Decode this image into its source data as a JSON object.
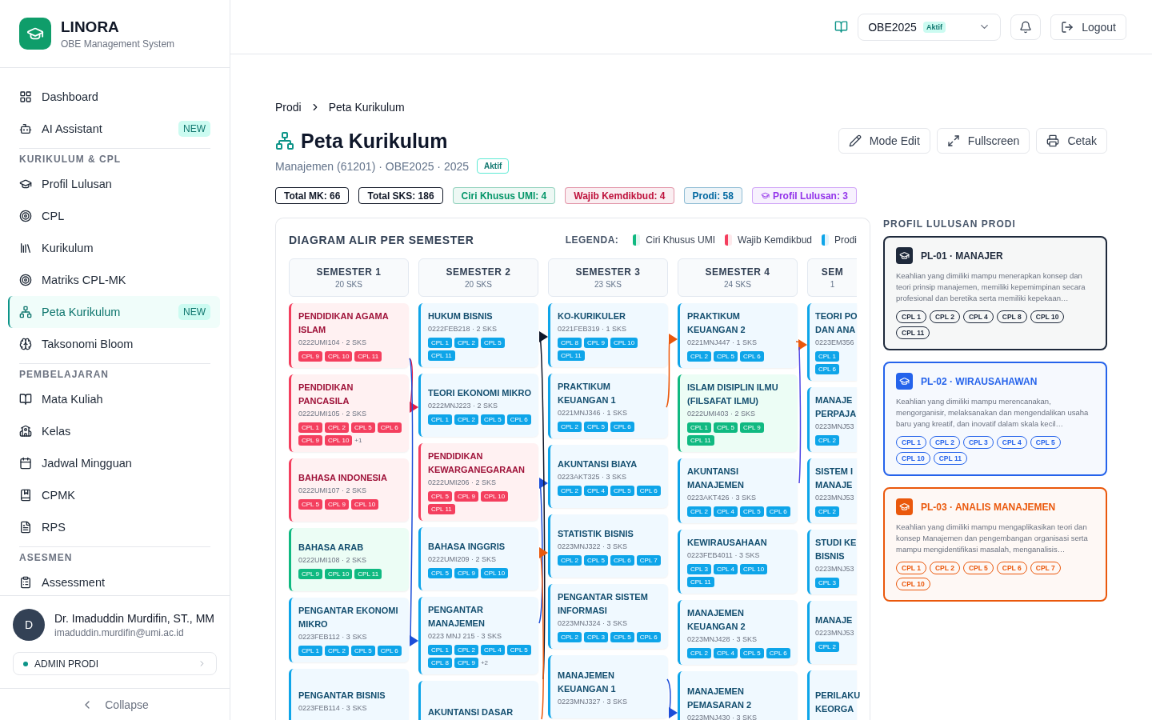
{
  "brand": {
    "name": "LINORA",
    "tagline": "OBE Management System"
  },
  "nav": [
    {
      "items": [
        {
          "label": "Dashboard",
          "kind": "dashboard",
          "selected": false
        },
        {
          "label": "AI Assistant",
          "kind": "bot",
          "selected": false,
          "badge": "NEW"
        }
      ]
    },
    {
      "heading": "KURIKULUM & CPL",
      "items": [
        {
          "label": "Profil Lulusan",
          "kind": "cap",
          "selected": false
        },
        {
          "label": "CPL",
          "kind": "target",
          "selected": false
        },
        {
          "label": "Kurikulum",
          "kind": "library",
          "selected": false
        },
        {
          "label": "Matriks CPL-MK",
          "kind": "target",
          "selected": false
        },
        {
          "label": "Peta Kurikulum",
          "kind": "network",
          "selected": true,
          "badge": "NEW"
        },
        {
          "label": "Taksonomi Bloom",
          "kind": "brain",
          "selected": false
        }
      ]
    },
    {
      "heading": "PEMBELAJARAN",
      "items": [
        {
          "label": "Mata Kuliah",
          "kind": "book",
          "selected": false
        },
        {
          "label": "Kelas",
          "kind": "school",
          "selected": false
        },
        {
          "label": "Jadwal Mingguan",
          "kind": "calendar",
          "selected": false
        },
        {
          "label": "CPMK",
          "kind": "bookmark",
          "selected": false
        },
        {
          "label": "RPS",
          "kind": "file",
          "selected": false
        }
      ]
    },
    {
      "heading": "ASESMEN",
      "items": [
        {
          "label": "Assessment",
          "kind": "clipboard",
          "selected": false
        }
      ]
    }
  ],
  "user": {
    "initial": "D",
    "name": "Dr. Imaduddin Murdifin, ST., MM",
    "email": "imaduddin.murdifin@umi.ac.id",
    "role": "ADMIN PRODI"
  },
  "collapse": "Collapse",
  "topbar": {
    "curriculum": "OBE2025",
    "curriculum_badge": "Aktif",
    "logout": "Logout"
  },
  "breadcrumb": [
    "Prodi",
    "Peta Kurikulum"
  ],
  "title": "Peta Kurikulum",
  "subtitle": "Manajemen (61201) · OBE2025 · 2025",
  "status_badge": "Aktif",
  "actions": [
    {
      "label": "Mode Edit",
      "kind": "edit"
    },
    {
      "label": "Fullscreen",
      "kind": "fullscreen"
    },
    {
      "label": "Cetak",
      "kind": "print"
    }
  ],
  "stats": [
    {
      "label": "Total MK: 66",
      "color": "#111827"
    },
    {
      "label": "Total SKS: 186",
      "color": "#111827"
    },
    {
      "label": "Ciri Khusus UMI: 4",
      "color": "#059669"
    },
    {
      "label": "Wajib Kemdikbud: 4",
      "color": "#be123c"
    },
    {
      "label": "Prodi: 58",
      "color": "#0369a1"
    },
    {
      "label": "Profil Lulusan: 3",
      "color": "#9333ea",
      "kind": "cap"
    }
  ],
  "diagram": {
    "title": "DIAGRAM ALIR PER SEMESTER",
    "legend_title": "LEGENDA:",
    "legend": [
      {
        "label": "Ciri Khusus UMI",
        "color": "#10b981"
      },
      {
        "label": "Wajib Kemdikbud",
        "color": "#f43f5e"
      },
      {
        "label": "Prodi",
        "color": "#0ea5e9"
      }
    ],
    "semesters": [
      {
        "title": "SEMESTER 1",
        "sks": "20 SKS",
        "courses": [
          {
            "name": "PENDIDIKAN AGAMA ISLAM",
            "meta": "0222UMI104 · 2 SKS",
            "kind": "kemdikbud",
            "cpl": [
              "CPL 9",
              "CPL 10",
              "CPL 11"
            ]
          },
          {
            "name": "PENDIDIKAN PANCASILA",
            "meta": "0222UMI105 · 2 SKS",
            "kind": "kemdikbud",
            "cpl": [
              "CPL 1",
              "CPL 2",
              "CPL 5",
              "CPL 6",
              "CPL 9",
              "CPL 10"
            ],
            "more": "+1"
          },
          {
            "name": "BAHASA INDONESIA",
            "meta": "0222UMI107 · 2 SKS",
            "kind": "kemdikbud",
            "cpl": [
              "CPL 5",
              "CPL 9",
              "CPL 10"
            ]
          },
          {
            "name": "BAHASA ARAB",
            "meta": "0222UMI108 · 2 SKS",
            "kind": "umi",
            "cpl": [
              "CPL 9",
              "CPL 10",
              "CPL 11"
            ]
          },
          {
            "name": "PENGANTAR EKONOMI MIKRO",
            "meta": "0223FEB112 · 3 SKS",
            "kind": "prodi",
            "cpl": [
              "CPL 1",
              "CPL 2",
              "CPL 5",
              "CPL 6"
            ]
          },
          {
            "name": "PENGANTAR BISNIS",
            "meta": "0223FEB114 · 3 SKS",
            "kind": "prodi"
          }
        ]
      },
      {
        "title": "SEMESTER 2",
        "sks": "20 SKS",
        "courses": [
          {
            "name": "HUKUM BISNIS",
            "meta": "0222FEB218 · 2 SKS",
            "kind": "prodi",
            "cpl": [
              "CPL 1",
              "CPL 2",
              "CPL 5",
              "CPL 11"
            ]
          },
          {
            "name": "TEORI EKONOMI MIKRO",
            "meta": "0222MNJ223 · 2 SKS",
            "kind": "prodi",
            "cpl": [
              "CPL 1",
              "CPL 2",
              "CPL 5",
              "CPL 6"
            ]
          },
          {
            "name": "PENDIDIKAN KEWARGANEGARAAN",
            "meta": "0222UMI206 · 2 SKS",
            "kind": "kemdikbud",
            "cpl": [
              "CPL 5",
              "CPL 9",
              "CPL 10",
              "CPL 11"
            ]
          },
          {
            "name": "BAHASA INGGRIS",
            "meta": "0222UMI209 · 2 SKS",
            "kind": "prodi",
            "cpl": [
              "CPL 5",
              "CPL 9",
              "CPL 10"
            ]
          },
          {
            "name": "PENGANTAR MANAJEMEN",
            "meta": "0223 MNJ 215 · 3 SKS",
            "kind": "prodi",
            "cpl": [
              "CPL 1",
              "CPL 2",
              "CPL 4",
              "CPL 5",
              "CPL 8",
              "CPL 9"
            ],
            "more": "+2"
          },
          {
            "name": "AKUNTANSI DASAR",
            "kind": "prodi"
          }
        ]
      },
      {
        "title": "SEMESTER 3",
        "sks": "23 SKS",
        "courses": [
          {
            "name": "KO-KURIKULER",
            "meta": "0221FEB319 · 1 SKS",
            "kind": "prodi",
            "cpl": [
              "CPL 8",
              "CPL 9",
              "CPL 10",
              "CPL 11"
            ]
          },
          {
            "name": "PRAKTIKUM KEUANGAN 1",
            "meta": "0221MNJ346 · 1 SKS",
            "kind": "prodi",
            "cpl": [
              "CPL 2",
              "CPL 5",
              "CPL 6"
            ]
          },
          {
            "name": "AKUNTANSI BIAYA",
            "meta": "0223AKT325 · 3 SKS",
            "kind": "prodi",
            "cpl": [
              "CPL 2",
              "CPL 4",
              "CPL 5",
              "CPL 6"
            ]
          },
          {
            "name": "STATISTIK BISNIS",
            "meta": "0223MNJ322 · 3 SKS",
            "kind": "prodi",
            "cpl": [
              "CPL 2",
              "CPL 5",
              "CPL 6",
              "CPL 7"
            ]
          },
          {
            "name": "PENGANTAR SISTEM INFORMASI",
            "meta": "0223MNJ324 · 3 SKS",
            "kind": "prodi",
            "cpl": [
              "CPL 2",
              "CPL 3",
              "CPL 5",
              "CPL 6"
            ]
          },
          {
            "name": "MANAJEMEN KEUANGAN 1",
            "meta": "0223MNJ327 · 3 SKS",
            "kind": "prodi"
          }
        ]
      },
      {
        "title": "SEMESTER 4",
        "sks": "24 SKS",
        "courses": [
          {
            "name": "PRAKTIKUM KEUANGAN 2",
            "meta": "0221MNJ447 · 1 SKS",
            "kind": "prodi",
            "cpl": [
              "CPL 2",
              "CPL 5",
              "CPL 6"
            ]
          },
          {
            "name": "ISLAM DISIPLIN ILMU (FILSAFAT ILMU)",
            "meta": "0222UMI403 · 2 SKS",
            "kind": "umi",
            "cpl": [
              "CPL 1",
              "CPL 5",
              "CPL 9",
              "CPL 11"
            ]
          },
          {
            "name": "AKUNTANSI MANAJEMEN",
            "meta": "0223AKT426 · 3 SKS",
            "kind": "prodi",
            "cpl": [
              "CPL 2",
              "CPL 4",
              "CPL 5",
              "CPL 6"
            ]
          },
          {
            "name": "KEWIRAUSAHAAN",
            "meta": "0223FEB4011 · 3 SKS",
            "kind": "prodi",
            "cpl": [
              "CPL 3",
              "CPL 4",
              "CPL 10",
              "CPL 11"
            ]
          },
          {
            "name": "MANAJEMEN KEUANGAN 2",
            "meta": "0223MNJ428 · 3 SKS",
            "kind": "prodi",
            "cpl": [
              "CPL 2",
              "CPL 4",
              "CPL 5",
              "CPL 6"
            ]
          },
          {
            "name": "MANAJEMEN PEMASARAN 2",
            "meta": "0223MNJ430 · 3 SKS",
            "kind": "prodi"
          }
        ]
      },
      {
        "title": "SEM",
        "sks": "1",
        "courses": [
          {
            "name": "TEORI PO\nDAN ANA",
            "meta": "0223EM356",
            "kind": "prodi",
            "cpl": [
              "CPL 1",
              "CPL 6"
            ]
          },
          {
            "name": "MANAJE\nPERPAJA",
            "meta": "0223MNJ53",
            "kind": "prodi",
            "cpl": [
              "CPL 2"
            ]
          },
          {
            "name": "SISTEM I\nMANAJE",
            "meta": "0223MNJ53",
            "kind": "prodi",
            "cpl": [
              "CPL 2"
            ]
          },
          {
            "name": "STUDI KE\nBISNIS",
            "meta": "0223MNJ53",
            "kind": "prodi",
            "cpl": [
              "CPL 3"
            ]
          },
          {
            "name": "MANAJE",
            "meta": "0223MNJ53",
            "kind": "prodi",
            "cpl": [
              "CPL 2"
            ]
          },
          {
            "name": "PERILAKU\nKEORGA",
            "kind": "prodi"
          }
        ]
      }
    ]
  },
  "profiles_title": "PROFIL LULUSAN PRODI",
  "profiles": [
    {
      "title": "PL-01 · MANAJER",
      "color": "#1e293b",
      "description": "Keahlian yang dimiliki mampu menerapkan konsep dan teori prinsip manajemen, memiliki kepemimpinan secara profesional dan beretika serta memiliki kepekaan…",
      "cpl": [
        "CPL 1",
        "CPL 2",
        "CPL 4",
        "CPL 8",
        "CPL 10",
        "CPL 11"
      ]
    },
    {
      "title": "PL-02 · WIRAUSAHAWAN",
      "color": "#2563eb",
      "description": "Keahlian yang dimiliki mampu merencanakan, mengorganisir, melaksanakan dan mengendalikan usaha baru yang kreatif, dan inovatif dalam skala kecil…",
      "cpl": [
        "CPL 1",
        "CPL 2",
        "CPL 3",
        "CPL 4",
        "CPL 5",
        "CPL 10",
        "CPL 11"
      ]
    },
    {
      "title": "PL-03 · ANALIS MANAJEMEN",
      "color": "#ea580c",
      "description": "Keahlian yang dimiliki mampu mengaplikasikan teori dan konsep Manajemen dan pengembangan organisasi serta mampu mengidentifikasi masalah, menganalisis…",
      "cpl": [
        "CPL 1",
        "CPL 2",
        "CPL 5",
        "CPL 6",
        "CPL 7",
        "CPL 10"
      ]
    }
  ]
}
